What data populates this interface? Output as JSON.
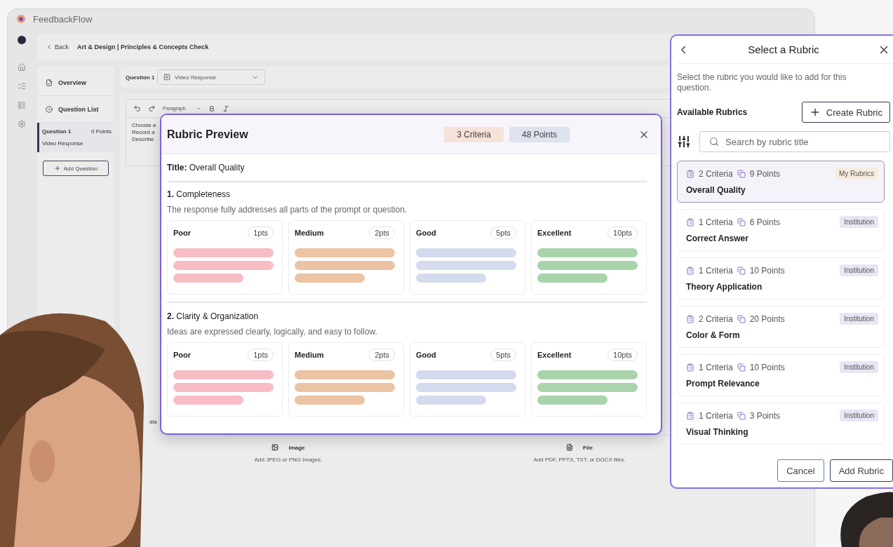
{
  "app": {
    "name": "FeedbackFlow",
    "breadcrumb": {
      "back": "Back",
      "course": "Art & Design",
      "separator": "|",
      "title": "Principles & Concepts Check"
    },
    "side_panel": {
      "items": [
        {
          "label": "Overview",
          "selected": false
        },
        {
          "label": "Question List",
          "selected": false
        }
      ],
      "question": {
        "title": "Question 1",
        "points": "0 Points",
        "type": "Video Response",
        "selected": true
      },
      "add_button": "Add Question"
    },
    "question_bar": {
      "label": "Question 1",
      "type_select": "Video Response"
    },
    "editor": {
      "block_style": "Paragraph",
      "lines": [
        "Choose a",
        "Record a",
        "Describe"
      ]
    },
    "partial_label": "dia",
    "attachments": [
      {
        "title": "Image",
        "hint": "Add JPEG or PNG images."
      },
      {
        "title": "File",
        "hint": "Add PDF, PPTX, TXT, or DOCX files."
      }
    ]
  },
  "rubric_preview": {
    "title": "Rubric Preview",
    "criteria_count": "3 Criteria",
    "points": "48 Points",
    "rubric_title": "**Title:** Overall Quality",
    "criteria": [
      {
        "name": "**1.** Completeness",
        "description": "The response fully addresses all parts of the prompt or question.",
        "levels": [
          {
            "name": "Poor",
            "points": "1pts",
            "color": "#f8bcc4"
          },
          {
            "name": "Medium",
            "points": "2pts",
            "color": "#ecc3a3"
          },
          {
            "name": "Good",
            "points": "5pts",
            "color": "#d4dbee"
          },
          {
            "name": "Excellent",
            "points": "10pts",
            "color": "#a9d4ab"
          }
        ]
      },
      {
        "name": "**2.** Clarity & Organization",
        "description": "Ideas are expressed clearly, logically, and easy to follow.",
        "levels": [
          {
            "name": "Poor",
            "points": "1pts",
            "color": "#f8bcc4"
          },
          {
            "name": "Medium",
            "points": "2pts",
            "color": "#ecc3a3"
          },
          {
            "name": "Good",
            "points": "5pts",
            "color": "#d4dbee"
          },
          {
            "name": "Excellent",
            "points": "10pts",
            "color": "#a9d4ab"
          }
        ]
      }
    ]
  },
  "select_panel": {
    "title": "Select a Rubric",
    "description": "Select the rubric you would like to add for this question.",
    "section_label": "Available Rubrics",
    "create_button": "Create Rubric",
    "search": {
      "placeholder": "Search by rubric title"
    },
    "rubrics": [
      {
        "criteria": "2 Criteria",
        "points": "9 Points",
        "source": "My Rubrics",
        "color": "#f8ecdd",
        "name": "Overall Quality",
        "selected": true
      },
      {
        "criteria": "1 Criteria",
        "points": "6 Points",
        "source": "Institution",
        "color": "#e7e6f3",
        "name": "Correct Answer",
        "selected": false
      },
      {
        "criteria": "1 Criteria",
        "points": "10 Points",
        "source": "Institution",
        "color": "#e7e6f3",
        "name": "Theory Application",
        "selected": false
      },
      {
        "criteria": "2 Criteria",
        "points": "20 Points",
        "source": "Institution",
        "color": "#e7e6f3",
        "name": "Color & Form",
        "selected": false
      },
      {
        "criteria": "1 Criteria",
        "points": "10 Points",
        "source": "Institution",
        "color": "#e7e6f3",
        "name": "Prompt Relevance",
        "selected": false
      },
      {
        "criteria": "1 Criteria",
        "points": "3 Points",
        "source": "Institution",
        "color": "#e7e6f3",
        "name": "Visual Thinking",
        "selected": false
      }
    ],
    "buttons": {
      "cancel": "Cancel",
      "add": "Add Rubric"
    }
  }
}
